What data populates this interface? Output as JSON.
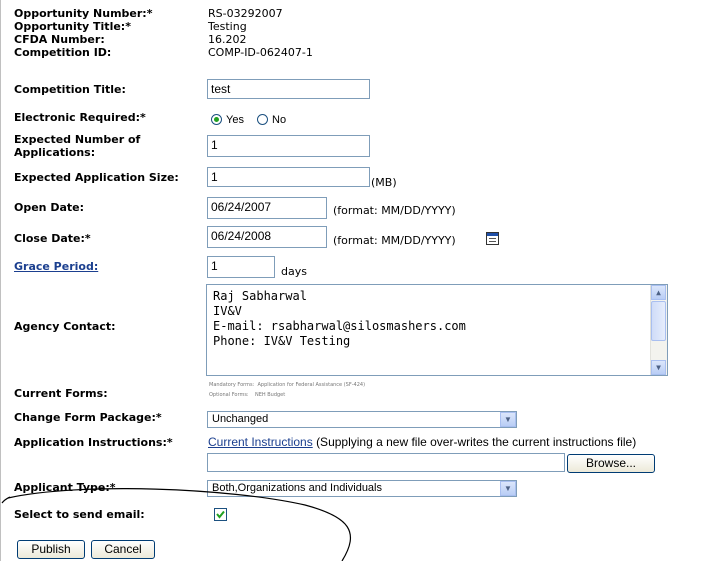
{
  "opportunity_number": {
    "label": "Opportunity Number:*",
    "value": "RS-03292007"
  },
  "opportunity_title": {
    "label": "Opportunity Title:*",
    "value": "Testing"
  },
  "cfda_number": {
    "label": "CFDA Number:",
    "value": "16.202"
  },
  "competition_id": {
    "label": "Competition ID:",
    "value": "COMP-ID-062407-1"
  },
  "competition_title": {
    "label": "Competition Title:",
    "value": "test"
  },
  "electronic_required": {
    "label": "Electronic Required:*",
    "yes": "Yes",
    "no": "No",
    "selected": "Yes"
  },
  "expected_applications": {
    "label_line1": "Expected Number of",
    "label_line2": "Applications:",
    "value": "1"
  },
  "expected_size": {
    "label": "Expected Application Size:",
    "value": "1",
    "unit": "(MB)"
  },
  "open_date": {
    "label": "Open Date:",
    "value": "06/24/2007",
    "format": "(format: MM/DD/YYYY)"
  },
  "close_date": {
    "label": "Close Date:*",
    "value": "06/24/2008",
    "format": "(format: MM/DD/YYYY)"
  },
  "grace_period": {
    "label": "Grace Period:",
    "value": "1",
    "unit": "days"
  },
  "agency_contact": {
    "label": "Agency Contact:",
    "lines": [
      "Raj Sabharwal",
      "IV&V",
      "E-mail: rsabharwal@silosmashers.com",
      "Phone: IV&V Testing"
    ]
  },
  "current_forms": {
    "label": "Current Forms:",
    "mandatory": "Mandatory Forms:  Application for Federal Assistance (SF-424)",
    "optional": "Optional Forms:    NEH Budget"
  },
  "change_form_package": {
    "label": "Change Form Package:*",
    "value": "Unchanged"
  },
  "application_instructions": {
    "label": "Application Instructions:*",
    "link": "Current Instructions",
    "note": "(Supplying a new file over-writes the current instructions file)",
    "browse": "Browse..."
  },
  "applicant_type": {
    "label": "Applicant Type:*",
    "value": "Both,Organizations and Individuals"
  },
  "send_email": {
    "label": "Select to send email:",
    "checked": true
  },
  "buttons": {
    "publish": "Publish",
    "cancel": "Cancel"
  }
}
